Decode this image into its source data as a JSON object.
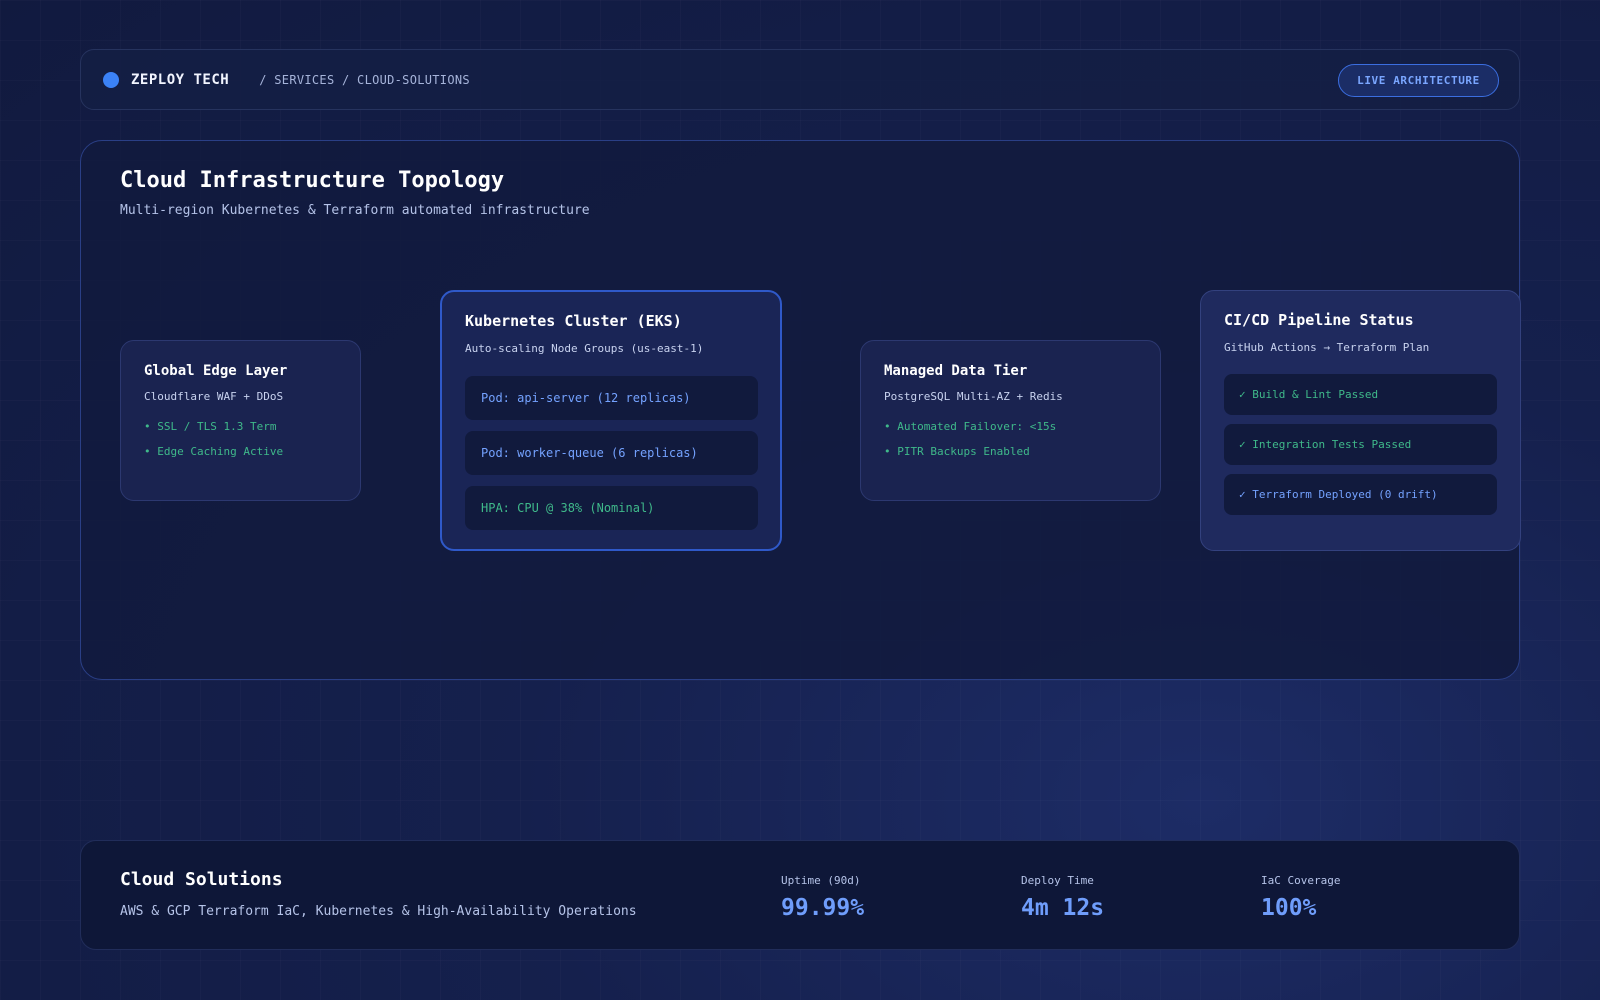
{
  "header": {
    "brand": "ZEPLOY TECH",
    "breadcrumb": "/ SERVICES / CLOUD-SOLUTIONS",
    "live_button": "LIVE ARCHITECTURE"
  },
  "topology": {
    "title": "Cloud Infrastructure Topology",
    "subtitle": "Multi-region Kubernetes & Terraform automated infrastructure",
    "edge": {
      "title": "Global Edge Layer",
      "subtitle": "Cloudflare WAF + DDoS",
      "bullets": [
        "• SSL / TLS 1.3 Term",
        "• Edge Caching Active"
      ]
    },
    "k8s": {
      "title": "Kubernetes Cluster (EKS)",
      "subtitle": "Auto-scaling Node Groups (us-east-1)",
      "pods": [
        "Pod: api-server (12 replicas)",
        "Pod: worker-queue (6 replicas)",
        "HPA: CPU @ 38% (Nominal)"
      ]
    },
    "data_tier": {
      "title": "Managed Data Tier",
      "subtitle": "PostgreSQL Multi-AZ + Redis",
      "bullets": [
        "• Automated Failover: <15s",
        "• PITR Backups Enabled"
      ]
    },
    "cicd": {
      "title": "CI/CD Pipeline Status",
      "subtitle": "GitHub Actions → Terraform Plan",
      "steps": [
        "✓ Build & Lint Passed",
        "✓ Integration Tests Passed",
        "✓ Terraform Deployed (0 drift)"
      ]
    }
  },
  "footer": {
    "title": "Cloud Solutions",
    "description": "AWS & GCP Terraform IaC, Kubernetes & High-Availability Operations",
    "metrics": [
      {
        "label": "Uptime (90d)",
        "value": "99.99%"
      },
      {
        "label": "Deploy Time",
        "value": "4m 12s"
      },
      {
        "label": "IaC Coverage",
        "value": "100%"
      }
    ]
  },
  "colors": {
    "accent": "#3b82f6",
    "success": "#3fb98a",
    "metric": "#6f9dfb"
  }
}
